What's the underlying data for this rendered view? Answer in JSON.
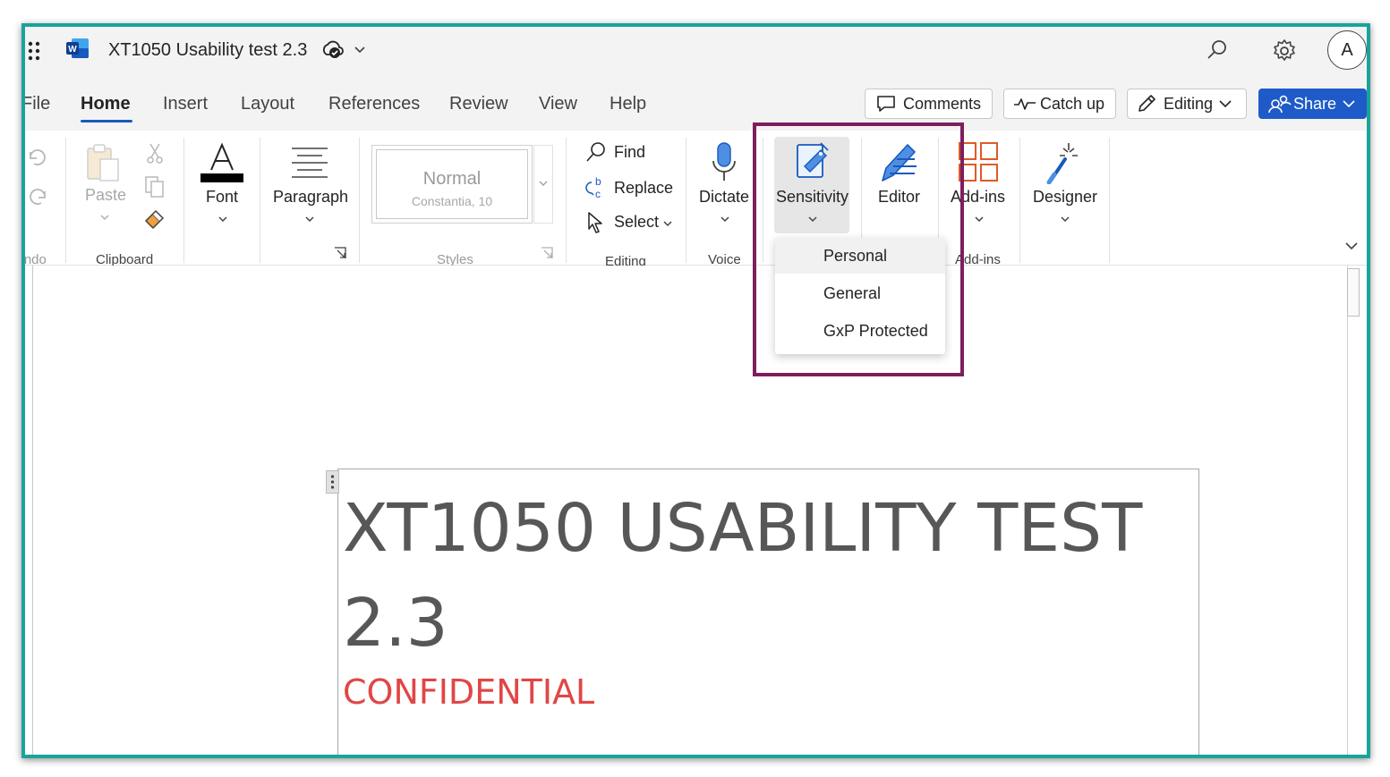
{
  "titlebar": {
    "doc_title": "XT1050 Usability test 2.3",
    "avatar_initial": "A",
    "app_icon_letter": "W"
  },
  "tabs": [
    {
      "label": "File"
    },
    {
      "label": "Home",
      "active": true
    },
    {
      "label": "Insert"
    },
    {
      "label": "Layout"
    },
    {
      "label": "References"
    },
    {
      "label": "Review"
    },
    {
      "label": "View"
    },
    {
      "label": "Help"
    }
  ],
  "actions": {
    "comments": "Comments",
    "catch_up": "Catch up",
    "editing": "Editing",
    "share": "Share"
  },
  "ribbon": {
    "undo_group": "Undo",
    "paste": "Paste",
    "clipboard_group": "Clipboard",
    "font": "Font",
    "paragraph": "Paragraph",
    "style_name": "Normal",
    "style_detail": "Constantia, 10",
    "styles_group": "Styles",
    "find": "Find",
    "replace": "Replace",
    "select": "Select",
    "editing_group": "Editing",
    "dictate": "Dictate",
    "voice_group": "Voice",
    "sensitivity": "Sensitivity",
    "editor": "Editor",
    "addins": "Add-ins",
    "addins_group": "Add-ins",
    "designer": "Designer"
  },
  "sensitivity_menu": {
    "items": [
      "Personal",
      "General",
      "GxP Protected"
    ]
  },
  "document": {
    "heading": "XT1050 USABILITY TEST 2.3",
    "confidential": "CONFIDENTIAL"
  },
  "colors": {
    "accent": "#185abd",
    "share_bg": "#1f5bc8",
    "frame": "#1aa39a",
    "highlight_box": "#7e1f5d",
    "confidential": "#e14646"
  }
}
